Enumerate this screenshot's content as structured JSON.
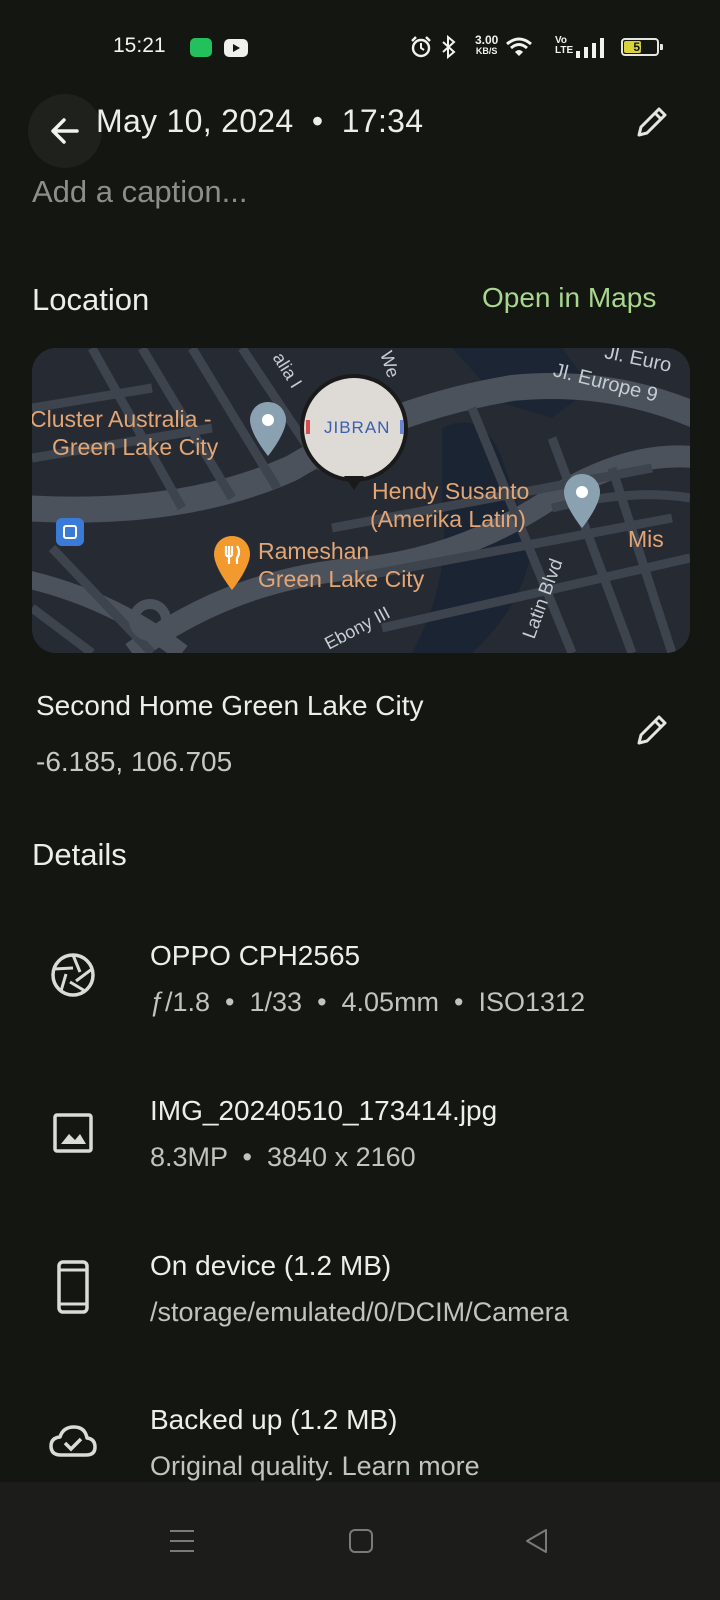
{
  "status_bar": {
    "time": "15:21",
    "net_speed_value": "3.00",
    "net_speed_unit": "KB/S",
    "volte_top": "Vo",
    "volte_bottom": "LTE",
    "battery": "51",
    "battery_level_percent": 51
  },
  "header": {
    "title": "May 10, 2024  •  17:34",
    "caption_placeholder": "Add a caption..."
  },
  "location": {
    "section_title": "Location",
    "open_maps_label": "Open in Maps",
    "place_name": "Second Home Green Lake City",
    "coordinates": "-6.185, 106.705",
    "map": {
      "poi_1": "Cluster Australia -",
      "poi_1b": "Green Lake City",
      "poi_2": "Hendy Susanto",
      "poi_2b": "(Amerika Latin)",
      "poi_3": "Rameshan",
      "poi_3b": "Green Lake City",
      "poi_4": "Mis",
      "street_1": "Jl. Europe 9",
      "street_2": "Jl. Euro",
      "street_3": "Latin Blvd",
      "street_4": "Ebony III",
      "street_5": "alia I",
      "street_6": "We",
      "photo_text": "JIBRAN"
    }
  },
  "details": {
    "section_title": "Details",
    "items": [
      {
        "icon": "camera-aperture-icon",
        "title": "OPPO CPH2565",
        "subtitle": "ƒ/1.8  •  1/33  •  4.05mm  •  ISO1312"
      },
      {
        "icon": "image-icon",
        "title": "IMG_20240510_173414.jpg",
        "subtitle": "8.3MP  •  3840 x 2160"
      },
      {
        "icon": "phone-icon",
        "title": "On device (1.2 MB)",
        "subtitle": "/storage/emulated/0/DCIM/Camera"
      },
      {
        "icon": "cloud-done-icon",
        "title": "Backed up (1.2 MB)",
        "subtitle": "Original quality. Learn more"
      }
    ]
  },
  "colors": {
    "background": "#141612",
    "accent": "#a8d68c",
    "map_label": "#e3a574"
  }
}
